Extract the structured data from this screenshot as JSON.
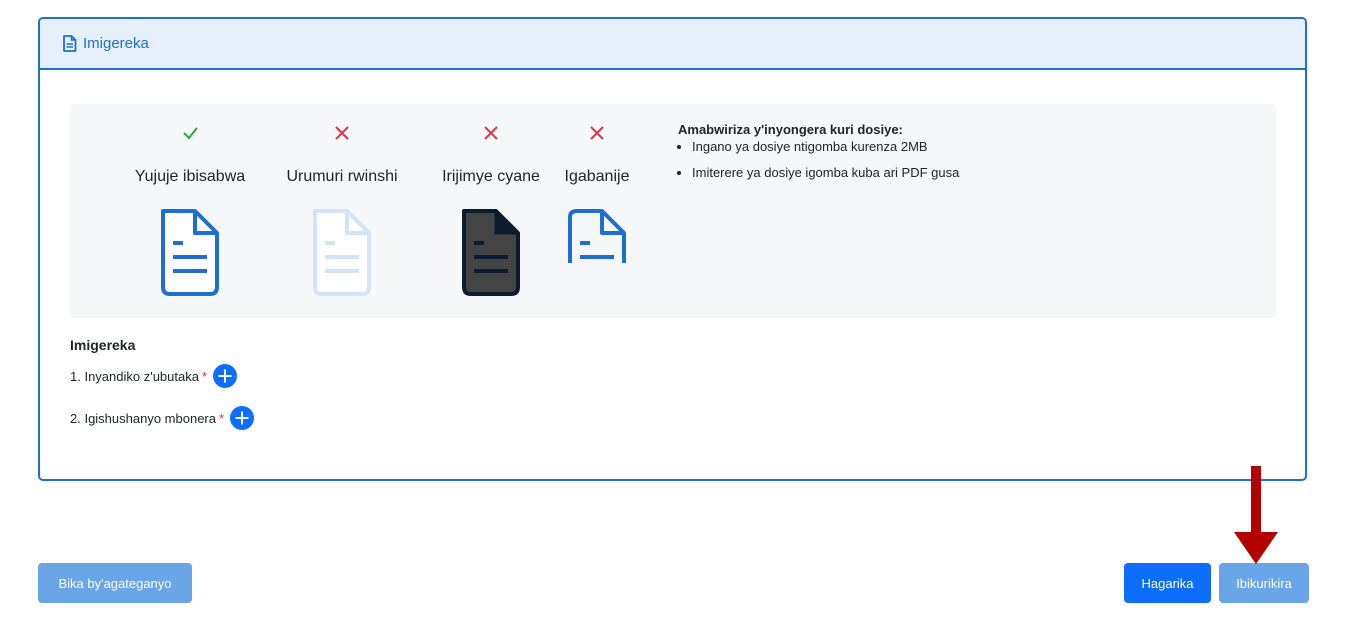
{
  "card": {
    "title": "Imigereka",
    "header_icon": "file-text-icon"
  },
  "guide": {
    "examples": [
      {
        "status": "check",
        "label": "Yujuje ibisabwa",
        "icon": "document-good-icon"
      },
      {
        "status": "cross",
        "label": "Urumuri rwinshi",
        "icon": "document-bright-icon"
      },
      {
        "status": "cross",
        "label": "Irijimye cyane",
        "icon": "document-dark-icon"
      },
      {
        "status": "cross",
        "label": "Igabanije",
        "icon": "document-cropped-icon"
      }
    ],
    "rules_title": "Amabwiriza y'inyongera kuri dosiye:",
    "rules": [
      "Ingano ya dosiye ntigomba kurenza 2MB",
      "Imiterere ya dosiye igomba kuba ari PDF gusa"
    ]
  },
  "attachments": {
    "title": "Imigereka",
    "items": [
      {
        "label": "1. Inyandiko z'ubutaka",
        "required": "*"
      },
      {
        "label": "2. Igishushanyo mbonera",
        "required": "*"
      }
    ]
  },
  "buttons": {
    "draft": "Bika by'agateganyo",
    "cancel": "Hagarika",
    "submit": "Ibikurikira"
  },
  "colors": {
    "accent": "#1e6fd0",
    "check": "#28a745",
    "cross": "#dc3545",
    "arrow": "#b30000"
  }
}
